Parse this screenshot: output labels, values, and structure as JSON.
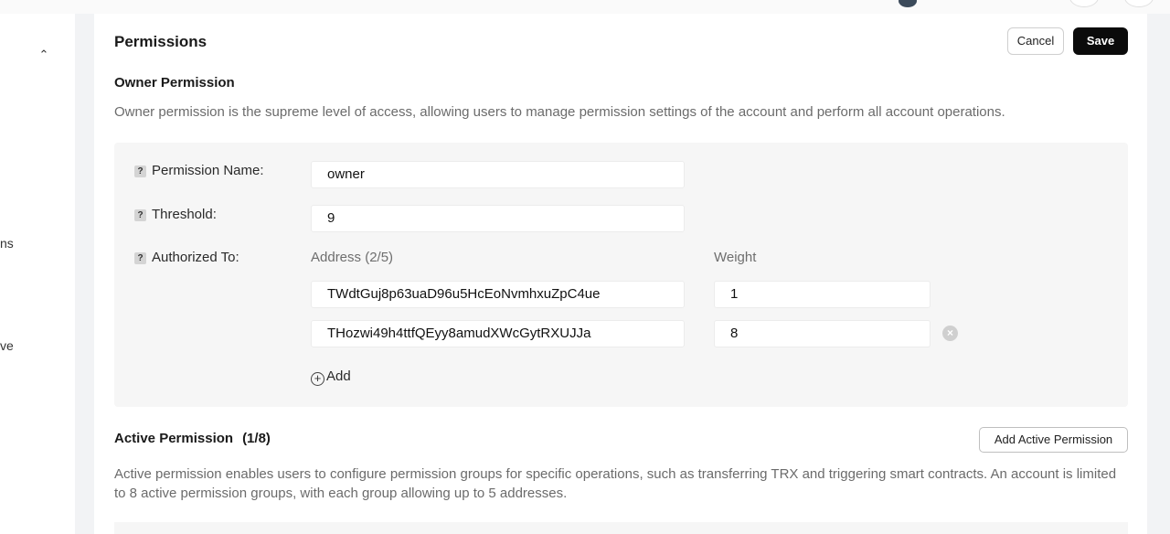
{
  "sidebar": {
    "fragment_1": "ns",
    "fragment_2": "ve"
  },
  "permissions": {
    "title": "Permissions",
    "cancel_label": "Cancel",
    "save_label": "Save"
  },
  "owner": {
    "heading": "Owner Permission",
    "description": "Owner permission is the supreme level of access, allowing users to manage permission settings of the account and perform all account operations.",
    "help_glyph": "?",
    "name_label": "Permission Name:",
    "name_value": "owner",
    "threshold_label": "Threshold:",
    "threshold_value": "9",
    "authorized_label": "Authorized To:",
    "address_header": "Address (2/5)",
    "weight_header": "Weight",
    "keys": [
      {
        "address": "TWdtGuj8p63uaD96u5HcEoNvmhxuZpC4ue",
        "weight": "1"
      },
      {
        "address": "THozwi49h4ttfQEyy8amudXWcGytRXUJJa",
        "weight": "8"
      }
    ],
    "add_label": "Add"
  },
  "active": {
    "heading": "Active Permission",
    "count": "(1/8)",
    "add_button_label": "Add Active Permission",
    "description": "Active permission enables users to configure permission groups for specific operations, such as transferring TRX and triggering smart contracts. An account is limited to 8 active permission groups, with each group allowing up to 5 addresses."
  },
  "icons": {
    "collapse": "chevron-up-icon",
    "help": "question-icon",
    "remove": "close-circle-icon",
    "add": "plus-circle-icon"
  }
}
